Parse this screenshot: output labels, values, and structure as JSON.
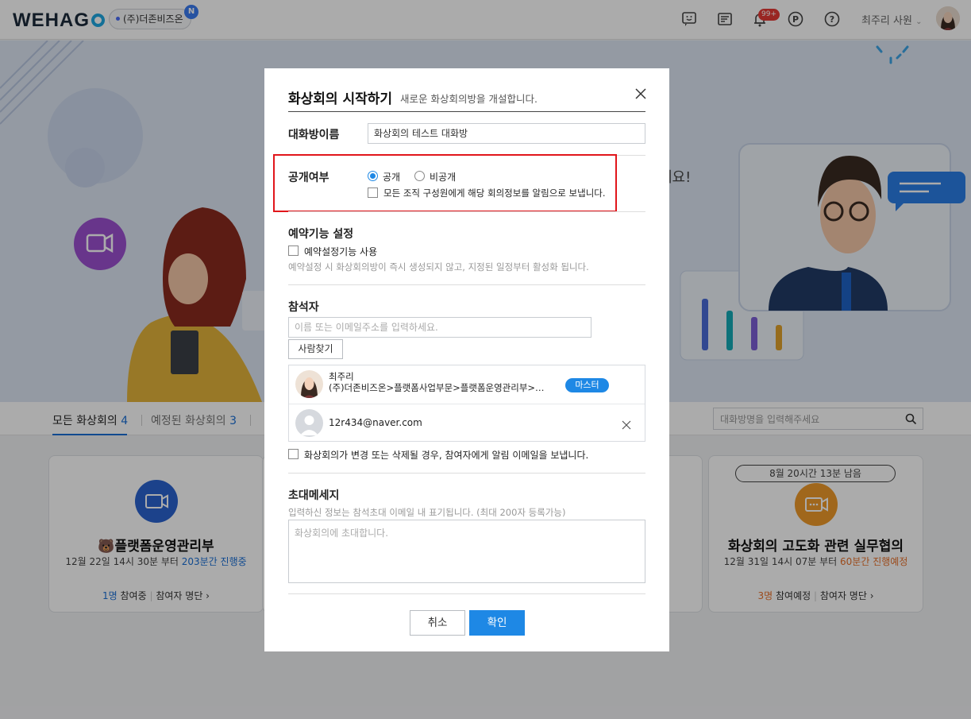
{
  "header": {
    "logo": "WEHAG",
    "company": "(주)더존비즈온",
    "company_badge": "N",
    "notification_count": "99+",
    "user_name": "최주리 사원",
    "icons": [
      "smile-icon",
      "board-icon",
      "bell-icon",
      "point-icon",
      "help-icon"
    ]
  },
  "hero": {
    "partial_text": "세요!"
  },
  "tabs": [
    {
      "label": "모든 화상회의",
      "count": "4"
    },
    {
      "label": "예정된 화상회의",
      "count": "3"
    }
  ],
  "search": {
    "placeholder": "대화방명을 입력해주세요"
  },
  "cards": [
    {
      "title": "🐻플랫폼운영관리부",
      "date": "12월 22일 14시 30분 부터",
      "status": "203분간 진행중",
      "participants": "1명",
      "participants_label": "참여중",
      "list_link": "참여자 명단 ›"
    },
    {
      "countdown": "8월 20시간 13분 남음",
      "title": "화상회의 고도화 관련 실무협의",
      "date": "12월 31일 14시 07분 부터",
      "status": "60분간 진행예정",
      "participants": "3명",
      "participants_label": "참여예정",
      "list_link": "참여자 명단 ›"
    }
  ],
  "modal": {
    "title": "화상회의 시작하기",
    "subtitle": "새로운 화상회의방을 개설합니다.",
    "room_name_label": "대화방이름",
    "room_name_value": "화상회의 테스트 대화방",
    "visibility_label": "공개여부",
    "visibility_public": "공개",
    "visibility_private": "비공개",
    "visibility_selected": "공개",
    "notify_all_label": "모든 조직 구성원에게 해당 회의정보를 알림으로 보냅니다.",
    "reservation_title": "예약기능 설정",
    "reservation_checkbox": "예약설정기능 사용",
    "reservation_hint": "예약설정 시 화상회의방이 즉시 생성되지 않고, 지정된 일정부터 활성화 됩니다.",
    "participants_title": "참석자",
    "participants_placeholder": "이름 또는 이메일주소를 입력하세요.",
    "find_people_button": "사람찾기",
    "participants": [
      {
        "name": "최주리",
        "org": "(주)더존비즈온>플랫폼사업부문>플랫폼운영관리부>…",
        "role": "마스터"
      },
      {
        "email": "12r434@naver.com"
      }
    ],
    "email_notify_label": "화상회의가 변경 또는 삭제될 경우, 참여자에게 알림 이메일을 보냅니다.",
    "invite_title": "초대메세지",
    "invite_hint": "입력하신 정보는 참석초대 이메일 내 표기됩니다. (최대 200자 등록가능)",
    "invite_placeholder": "화상회의에 초대합니다.",
    "cancel_button": "취소",
    "confirm_button": "확인"
  },
  "colors": {
    "accent": "#1e88e5",
    "highlight": "#e1161b",
    "live": "#1a6fd6",
    "scheduled": "#e8702a"
  }
}
